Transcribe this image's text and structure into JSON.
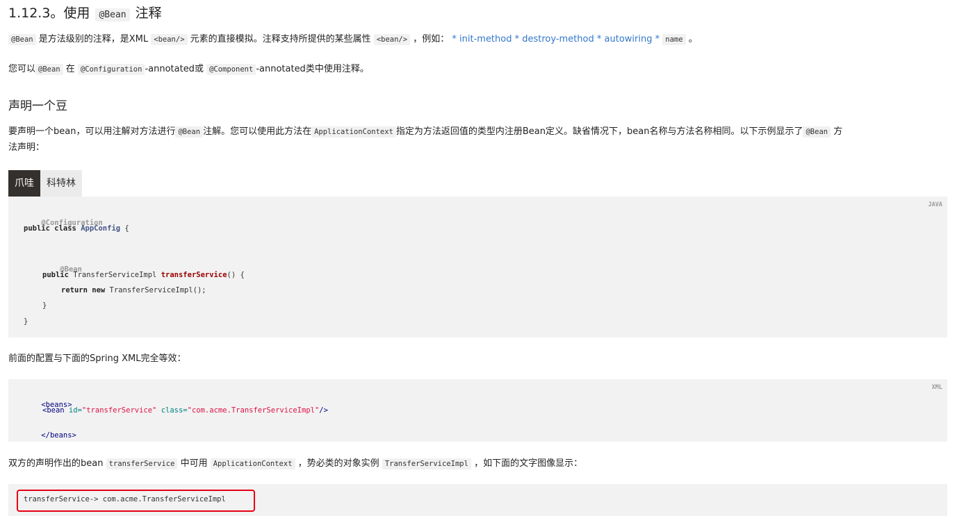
{
  "title": {
    "number": "1.12.3。使用",
    "code": "@Bean",
    "suffix": "注释"
  },
  "para1": {
    "code_bean": "@Bean",
    "text1": "是方法级别的注释，是XML",
    "code_bean_elem": "<bean/>",
    "text2": "元素的直接模拟。注释支持所提供的某些属性",
    "code_bean_elem2": "<bean/>",
    "text3": "，例如：",
    "links": [
      "* init-method",
      "* destroy-method",
      "* autowiring",
      "*"
    ],
    "code_name": "name",
    "text4": "。"
  },
  "para2": {
    "text1": "您可以",
    "code_bean": "@Bean",
    "text2": "在",
    "code_configuration": "@Configuration",
    "text3": "-annotated或",
    "code_component": "@Component",
    "text4": "-annotated类中使用注释。"
  },
  "section_heading": "声明一个豆",
  "para3": {
    "line1_text1": "要声明一个bean，可以用注解对方法进行",
    "code_bean": "@Bean",
    "line1_text2": "注解。您可以使用此方法在",
    "code_appctx": "ApplicationContext",
    "line1_text3": "指定为方法返回值的类型内注册Bean定义。缺省情况下，bean名称与方法名称相同。以下示例显示了",
    "code_bean2": "@Bean",
    "line1_text4": "方",
    "line2": "法声明："
  },
  "tabs": [
    {
      "label": "爪哇",
      "active": true
    },
    {
      "label": "科特林",
      "active": false
    }
  ],
  "java_block": {
    "lang": "JAVA",
    "l1": "@Configuration",
    "l2_kw": "public class ",
    "l2_cls": "AppConfig",
    "l2_rest": " {",
    "l4": "@Bean",
    "l5_kw": "public ",
    "l5_type": "TransferServiceImpl ",
    "l5_fn": "transferService",
    "l5_rest": "() {",
    "l6_kw": "return new ",
    "l6_rest": "TransferServiceImpl();",
    "l7": "}",
    "l8": "}"
  },
  "para4": "前面的配置与下面的Spring XML完全等效：",
  "xml_block": {
    "lang": "XML",
    "l1": "<beans>",
    "l2_tag": "<bean ",
    "l2_attr1": "id=",
    "l2_val1": "\"transferService\"",
    "l2_attr2": " class=",
    "l2_val2": "\"com.acme.TransferServiceImpl\"",
    "l2_end": "/>",
    "l3": "</beans>"
  },
  "para5": {
    "text1": "双方的声明作出的bean",
    "code_ts": "transferService",
    "text2": "中可用",
    "code_appctx": "ApplicationContext",
    "text3": "，势必类的对象实例",
    "code_tsi": "TransferServiceImpl",
    "text4": "，如下面的文字图像显示："
  },
  "output_block": {
    "line": "transferService-> com.acme.TransferServiceImpl"
  },
  "colors": {
    "link": "#3277c9",
    "tab_active_bg": "#34302d",
    "highlight": "#e60012"
  }
}
